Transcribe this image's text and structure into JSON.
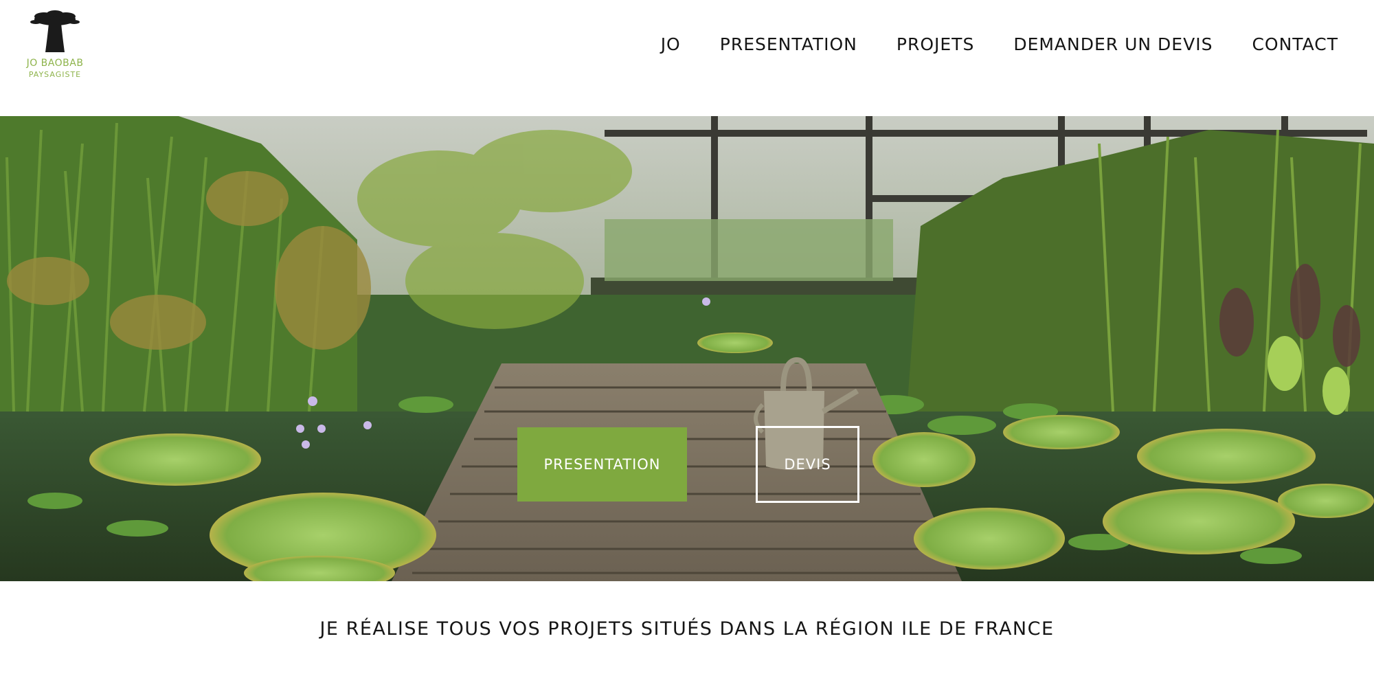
{
  "logo": {
    "name": "JO BAOBAB",
    "subtitle": "PAYSAGISTE",
    "accent_color": "#8db34a"
  },
  "nav": {
    "items": [
      {
        "label": "JO"
      },
      {
        "label": "PRESENTATION"
      },
      {
        "label": "PROJETS"
      },
      {
        "label": "DEMANDER UN DEVIS"
      },
      {
        "label": "CONTACT"
      }
    ]
  },
  "hero": {
    "buttons": {
      "presentation_label": "PRESENTATION",
      "devis_label": "DEVIS"
    },
    "button_color": "#7fa93f"
  },
  "tagline": "JE RÉALISE TOUS VOS PROJETS SITUÉS DANS LA RÉGION ILE DE FRANCE"
}
